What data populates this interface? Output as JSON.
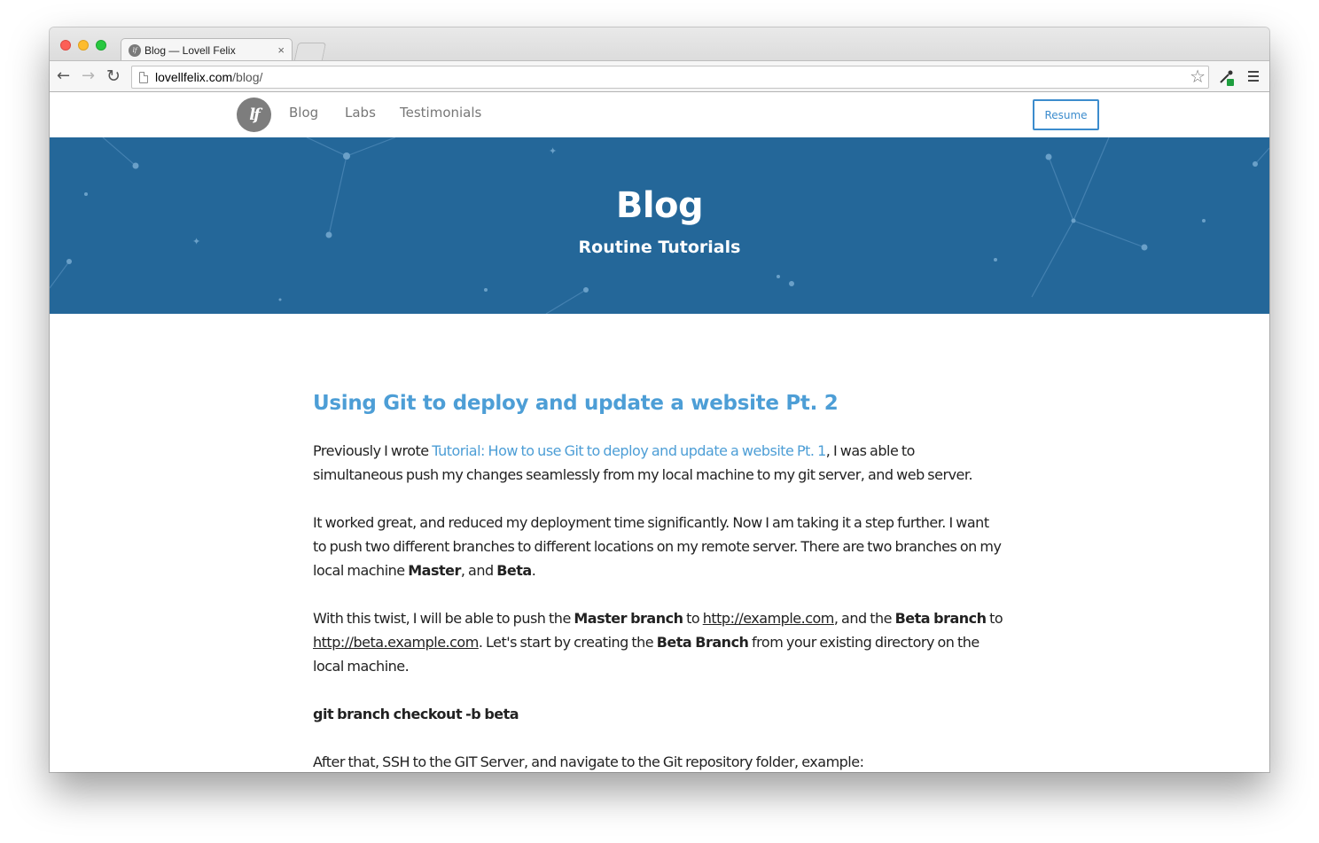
{
  "browser": {
    "tab_title": "Blog — Lovell Felix",
    "tab_close": "×",
    "url_host": "lovellfelix.com",
    "url_path": "/blog/",
    "back": "←",
    "forward": "→",
    "reload": "↻",
    "star": "☆"
  },
  "site": {
    "logo_text": "lf",
    "nav": [
      "Blog",
      "Labs",
      "Testimonials"
    ],
    "resume_label": "Resume"
  },
  "hero": {
    "title": "Blog",
    "subtitle": "Routine Tutorials",
    "background_color": "#246799"
  },
  "post": {
    "title": "Using Git to deploy and update a website Pt. 2",
    "p1_before": "Previously I wrote ",
    "p1_link": "Tutorial: How to use Git to deploy and update a website Pt. 1",
    "p1_after": ", I was able to simultaneous push my changes seamlessly from my local machine to my git server, and web server.",
    "p2_before": "It worked great, and reduced my deployment time significantly. Now I am taking it a step further. I want to push two different branches to different locations on my remote server. There are two branches on my local machine ",
    "p2_bold1": "Master",
    "p2_mid": ", and ",
    "p2_bold2": "Beta",
    "p2_end": ".",
    "p3_a": "With this twist, I will be able to push the ",
    "p3_b": "Master branch",
    "p3_c": " to ",
    "p3_d": "http://example.com",
    "p3_e": ", and the ",
    "p3_f": "Beta branch",
    "p3_g": " to ",
    "p3_h": "http://beta.example.com",
    "p3_i": ". Let's start by creating the ",
    "p3_j": "Beta Branch",
    "p3_k": " from your existing directory on the local machine.",
    "command": "git branch checkout -b beta",
    "p4": "After that, SSH to the GIT Server, and navigate to the Git repository folder, example:"
  },
  "colors": {
    "accent": "#4d9ed6",
    "button_border": "#3c8ccd"
  }
}
